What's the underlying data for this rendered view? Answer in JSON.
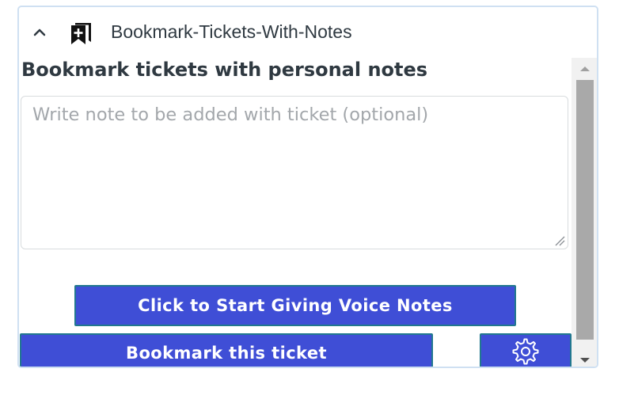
{
  "app": {
    "title": "Bookmark-Tickets-With-Notes",
    "collapse_icon": "chevron-up-icon",
    "icon": "bookmark-plus-icon"
  },
  "main": {
    "heading": "Bookmark tickets with personal notes",
    "note_input": {
      "placeholder": "Write note to be added with ticket (optional)",
      "value": ""
    },
    "voice_button_label": "Click to Start Giving Voice Notes",
    "bookmark_button_label": "Bookmark this ticket",
    "settings_button_icon": "gear-icon"
  },
  "colors": {
    "button_bg": "#3f4ed6",
    "button_border": "#21788f",
    "text": "#2f3941",
    "placeholder": "#a3a7ab",
    "panel_border": "#cfe0f2"
  }
}
